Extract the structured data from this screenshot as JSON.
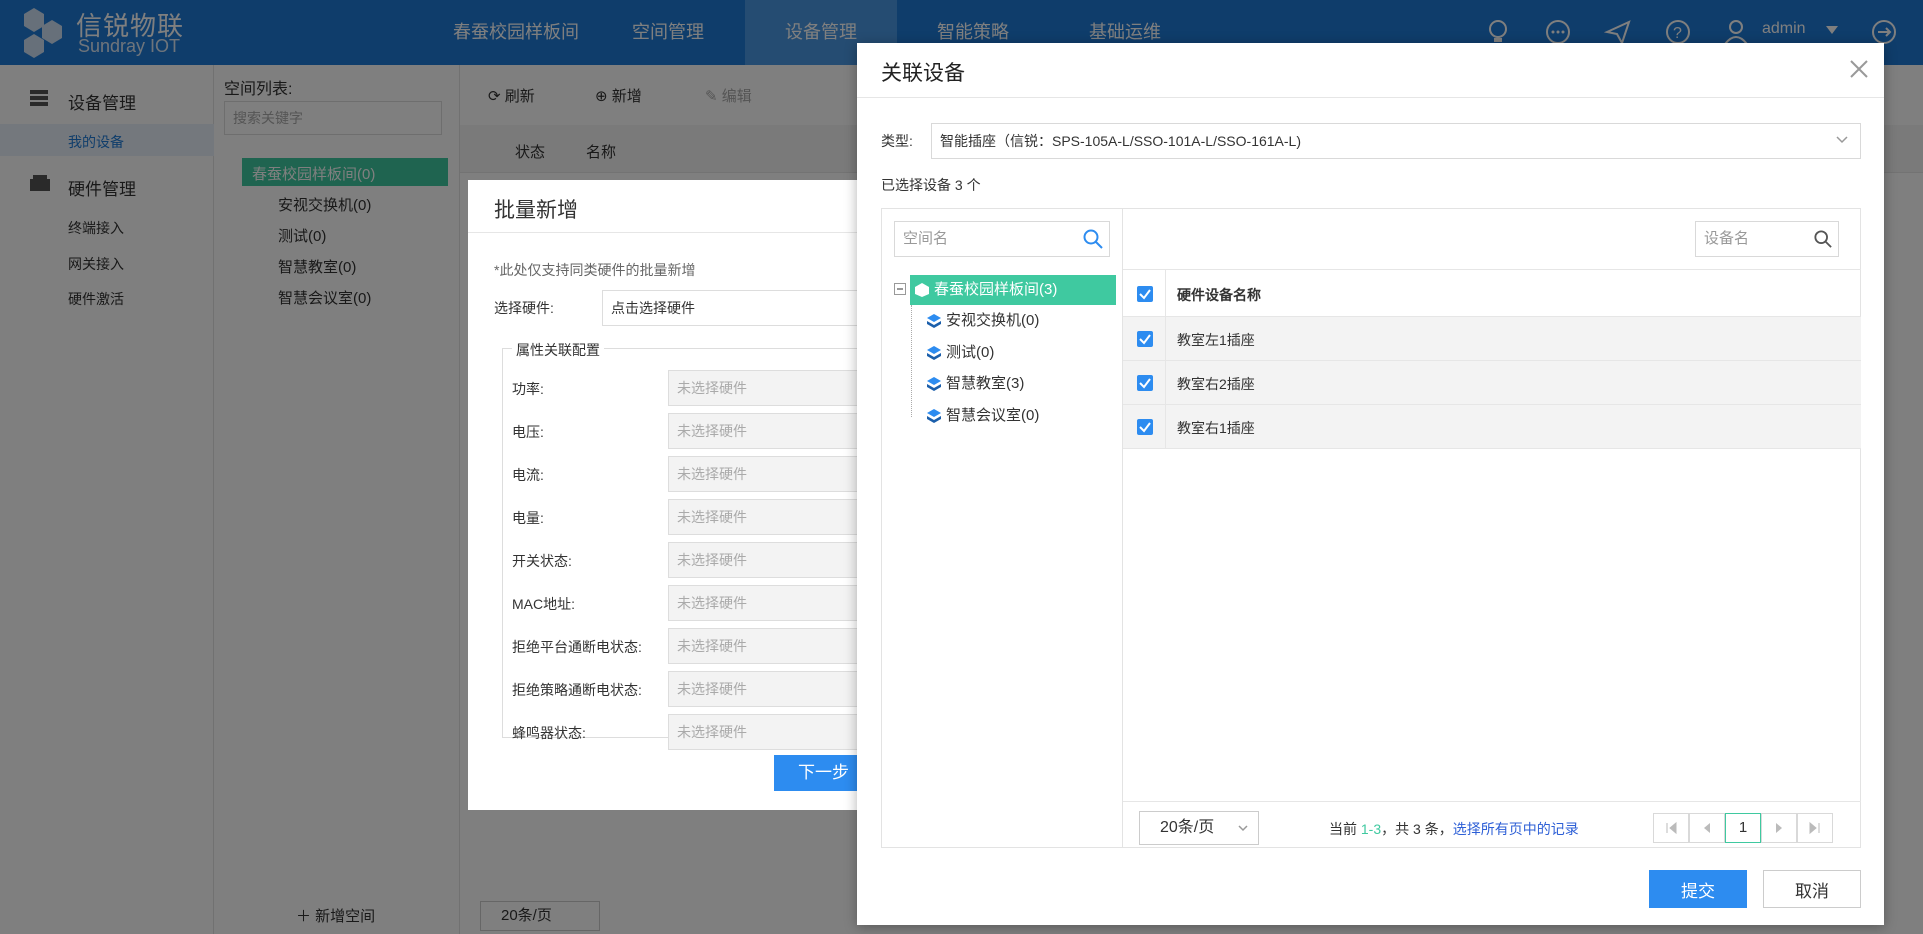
{
  "app": {
    "logo_cn": "信锐物联",
    "logo_en": "Sundray IOT"
  },
  "nav": {
    "items": [
      "春蚕校园样板间",
      "空间管理",
      "设备管理",
      "智能策略",
      "基础运维"
    ],
    "active_index": 2,
    "user": "admin"
  },
  "sidebar": {
    "group1": "设备管理",
    "group1_item": "我的设备",
    "group2": "硬件管理",
    "group2_items": [
      "终端接入",
      "网关接入",
      "硬件激活"
    ]
  },
  "space_panel": {
    "title": "空间列表:",
    "search_placeholder": "搜索关键字",
    "root": "春蚕校园样板间(0)",
    "children": [
      "安视交换机(0)",
      "测试(0)",
      "智慧教室(0)",
      "智慧会议室(0)"
    ],
    "add_space": "新增空间"
  },
  "toolbar": {
    "refresh": "刷新",
    "add": "新增",
    "edit": "编辑"
  },
  "table_header": {
    "status": "状态",
    "name": "名称"
  },
  "main_pager": "20条/页",
  "batch": {
    "title": "批量新增",
    "note": "*此处仅支持同类硬件的批量新增",
    "select_hw_label": "选择硬件:",
    "select_hw_value": "点击选择硬件",
    "attr_section": "属性关联配置",
    "fields": [
      "功率:",
      "电压:",
      "电流:",
      "电量:",
      "开关状态:",
      "MAC地址:",
      "拒绝平台通断电状态:",
      "拒绝策略通断电状态:",
      "蜂鸣器状态:"
    ],
    "field_placeholder": "未选择硬件",
    "next_btn": "下一步"
  },
  "modal": {
    "title": "关联设备",
    "type_label": "类型:",
    "type_value": "智能插座（信锐：SPS-105A-L/SSO-101A-L/SSO-161A-L)",
    "selected_text": "已选择设备 3 个",
    "space_search_placeholder": "空间名",
    "device_search_placeholder": "设备名",
    "tree": {
      "root": "春蚕校园样板间(3)",
      "children": [
        "安视交换机(0)",
        "测试(0)",
        "智慧教室(3)",
        "智慧会议室(0)"
      ]
    },
    "column_header": "硬件设备名称",
    "rows": [
      "教室左1插座",
      "教室右2插座",
      "教室右1插座"
    ],
    "page_size": "20条/页",
    "pager_prefix": "当前 ",
    "pager_range": "1-3",
    "pager_mid": "，共 3 条，",
    "pager_link": "选择所有页中的记录",
    "current_page": "1",
    "submit": "提交",
    "cancel": "取消"
  },
  "colors": {
    "primary": "#2d8cf0",
    "nav": "#1f7bd6",
    "tree_active": "#3fc9a0"
  }
}
